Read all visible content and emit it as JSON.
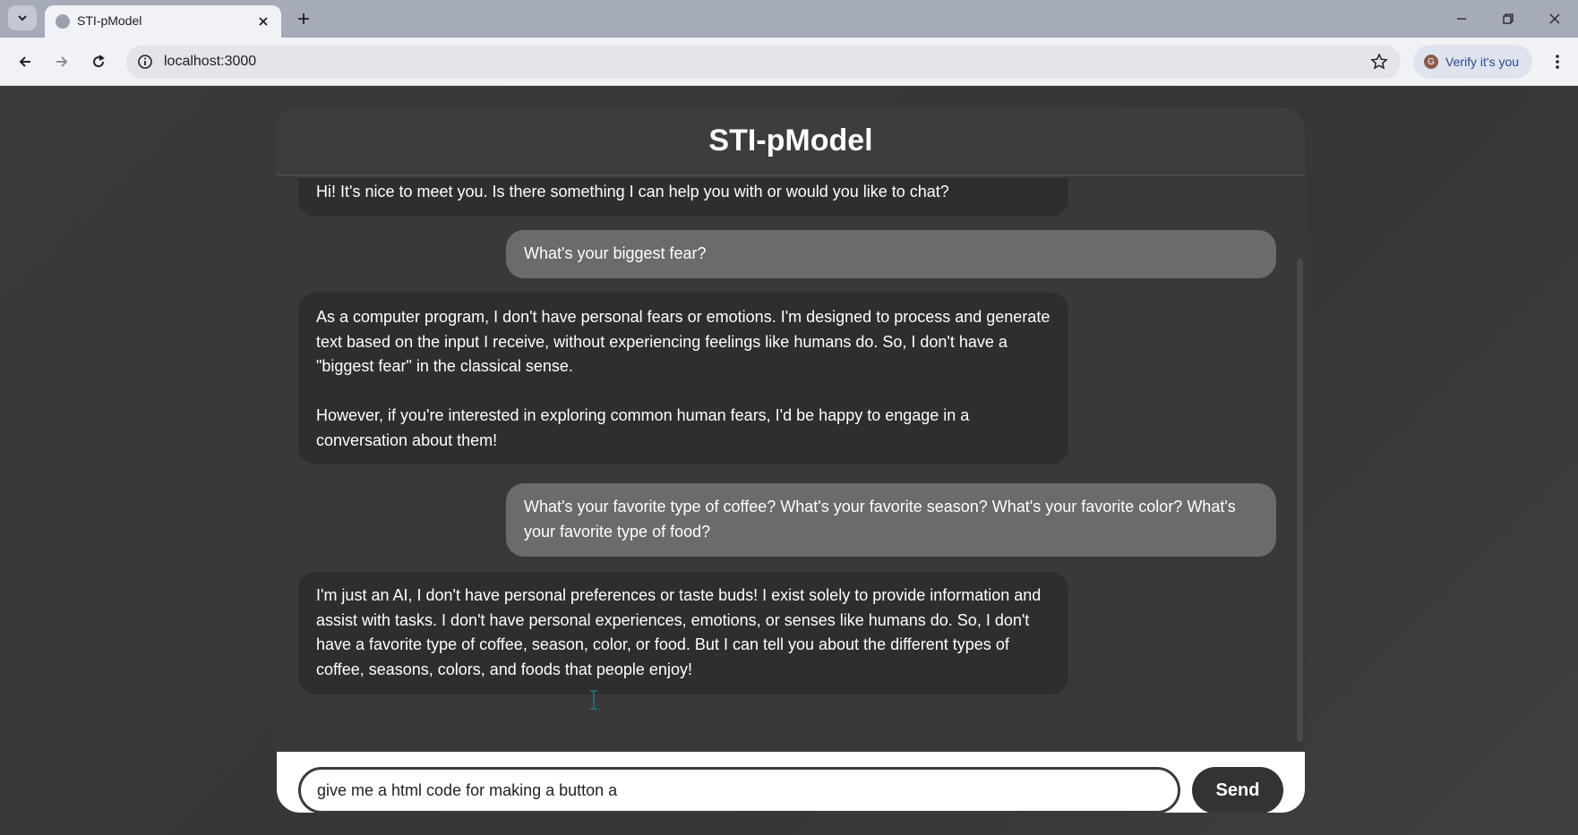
{
  "browser": {
    "tab_title": "STI-pModel",
    "url": "localhost:3000",
    "profile_initial": "G",
    "profile_label": "Verify it's you"
  },
  "chat": {
    "title": "STI-pModel",
    "messages": [
      {
        "role": "bot",
        "text": "Hi! It's nice to meet you. Is there something I can help you with or would you like to chat?"
      },
      {
        "role": "user",
        "text": "What's your biggest fear?"
      },
      {
        "role": "bot",
        "text": "As a computer program, I don't have personal fears or emotions. I'm designed to process and generate text based on the input I receive, without experiencing feelings like humans do. So, I don't have a \"biggest fear\" in the classical sense.\n\nHowever, if you're interested in exploring common human fears, I'd be happy to engage in a conversation about them!"
      },
      {
        "role": "user",
        "text": "What's your favorite type of coffee? What's your favorite season? What's your favorite color? What's your favorite type of food?"
      },
      {
        "role": "bot",
        "text": "I'm just an AI, I don't have personal preferences or taste buds! I exist solely to provide information and assist with tasks. I don't have personal experiences, emotions, or senses like humans do. So, I don't have a favorite type of coffee, season, color, or food. But I can tell you about the different types of coffee, seasons, colors, and foods that people enjoy!"
      }
    ],
    "input_value": "give me a html code for making a button a",
    "send_label": "Send"
  },
  "colors": {
    "page_bg": "#3b3b3b",
    "bot_bubble": "#2e2e2e",
    "user_bubble": "#6b6b6b",
    "send_button": "#333333"
  }
}
